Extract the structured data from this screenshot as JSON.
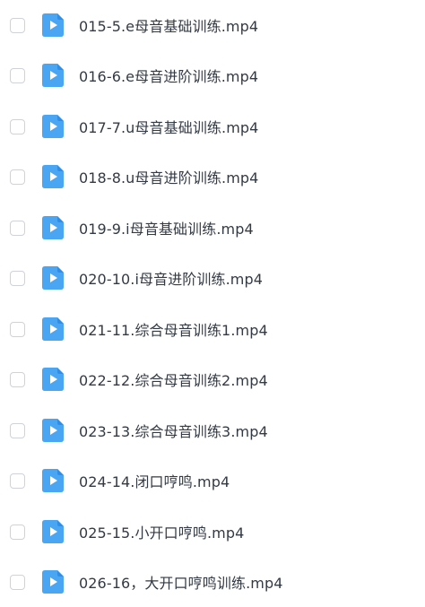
{
  "colors": {
    "icon_blue": "#4aa6f2",
    "icon_blue_dark": "#2f8ee6",
    "text": "#333a44",
    "checkbox_border": "#cfd3d9"
  },
  "files": [
    {
      "name": "015-5.e母音基础训练.mp4",
      "icon": "video-file-icon"
    },
    {
      "name": "016-6.e母音进阶训练.mp4",
      "icon": "video-file-icon"
    },
    {
      "name": "017-7.u母音基础训练.mp4",
      "icon": "video-file-icon"
    },
    {
      "name": "018-8.u母音进阶训练.mp4",
      "icon": "video-file-icon"
    },
    {
      "name": "019-9.i母音基础训练.mp4",
      "icon": "video-file-icon"
    },
    {
      "name": "020-10.i母音进阶训练.mp4",
      "icon": "video-file-icon"
    },
    {
      "name": "021-11.综合母音训练1.mp4",
      "icon": "video-file-icon"
    },
    {
      "name": "022-12.综合母音训练2.mp4",
      "icon": "video-file-icon"
    },
    {
      "name": "023-13.综合母音训练3.mp4",
      "icon": "video-file-icon"
    },
    {
      "name": "024-14.闭口哼鸣.mp4",
      "icon": "video-file-icon"
    },
    {
      "name": "025-15.小开口哼鸣.mp4",
      "icon": "video-file-icon"
    },
    {
      "name": "026-16，大开口哼鸣训练.mp4",
      "icon": "video-file-icon"
    }
  ]
}
